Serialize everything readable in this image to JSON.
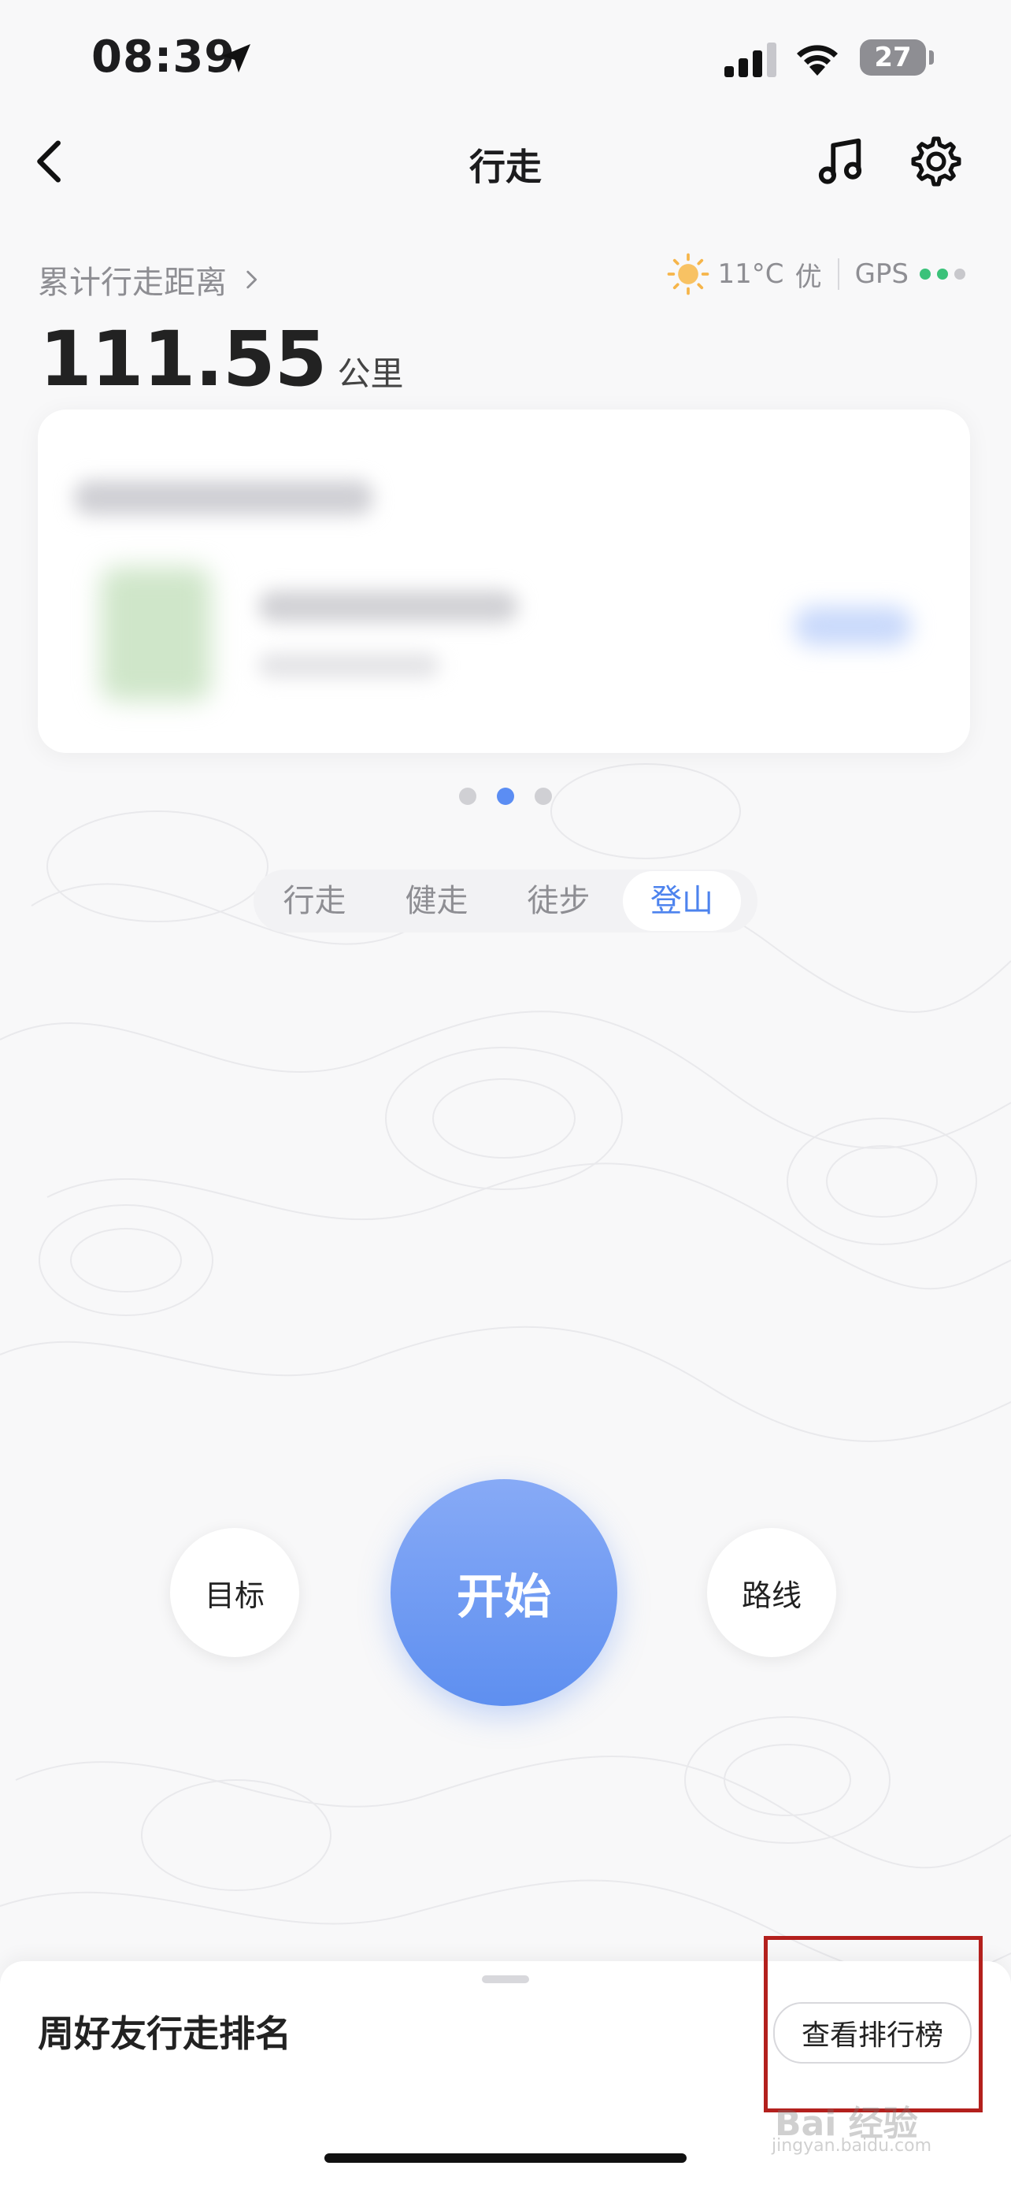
{
  "status_bar": {
    "time": "08:39",
    "battery": "27"
  },
  "nav": {
    "title": "行走",
    "back_icon": "chevron-left-icon",
    "music_icon": "music-note-icon",
    "settings_icon": "gear-icon"
  },
  "distance": {
    "label": "累计行走距离",
    "value": "111.55",
    "unit": "公里"
  },
  "weather": {
    "temperature": "11°C",
    "air_quality": "优",
    "gps_label": "GPS",
    "gps_colors": [
      "#3bc27a",
      "#3bc27a",
      "#c8c8cc"
    ]
  },
  "pager": {
    "count": 3,
    "active_index": 1
  },
  "modes": {
    "items": [
      "行走",
      "健走",
      "徒步",
      "登山"
    ],
    "active_index": 3
  },
  "actions": {
    "goal": "目标",
    "start": "开始",
    "route": "路线"
  },
  "sheet": {
    "title": "周好友行走排名",
    "ranking_button": "查看排行榜"
  },
  "watermark": {
    "text": "Bai 经验",
    "url": "jingyan.baidu.com"
  },
  "colors": {
    "accent": "#5e8ff0",
    "active_tab": "#4d83ee",
    "highlight": "#b3201d"
  }
}
